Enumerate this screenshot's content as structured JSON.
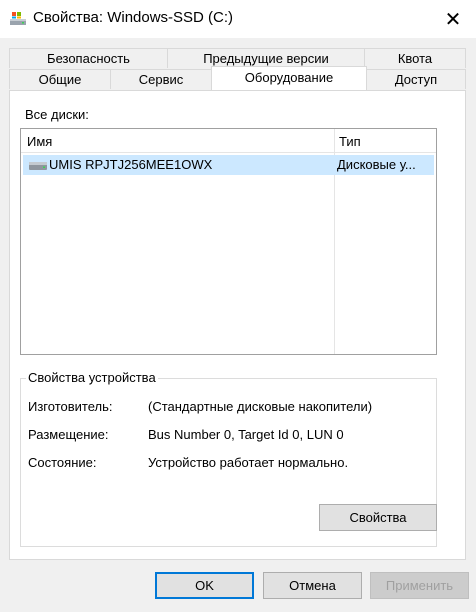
{
  "window": {
    "title": "Свойства: Windows-SSD (C:)",
    "close_glyph": "✕"
  },
  "tabs": {
    "row_back": [
      "Безопасность",
      "Предыдущие версии",
      "Квота"
    ],
    "row_front": [
      "Общие",
      "Сервис",
      "Оборудование",
      "Доступ"
    ],
    "active": "Оборудование"
  },
  "disks": {
    "label": "Все диски:",
    "columns": [
      "Имя",
      "Тип"
    ],
    "rows": [
      {
        "name": "UMIS RPJTJ256MEE1OWX",
        "type": "Дисковые у...",
        "selected": true
      }
    ]
  },
  "device": {
    "group_title": "Свойства устройства",
    "fields": [
      {
        "label": "Изготовитель:",
        "value": "(Стандартные дисковые накопители)"
      },
      {
        "label": "Размещение:",
        "value": "Bus Number 0, Target Id 0, LUN 0"
      },
      {
        "label": "Состояние:",
        "value": "Устройство работает нормально."
      }
    ],
    "properties_button": "Свойства"
  },
  "footer": {
    "ok": "OK",
    "cancel": "Отмена",
    "apply": "Применить"
  },
  "colors": {
    "selection": "#cce8ff",
    "default_button_border": "#0078d7"
  }
}
